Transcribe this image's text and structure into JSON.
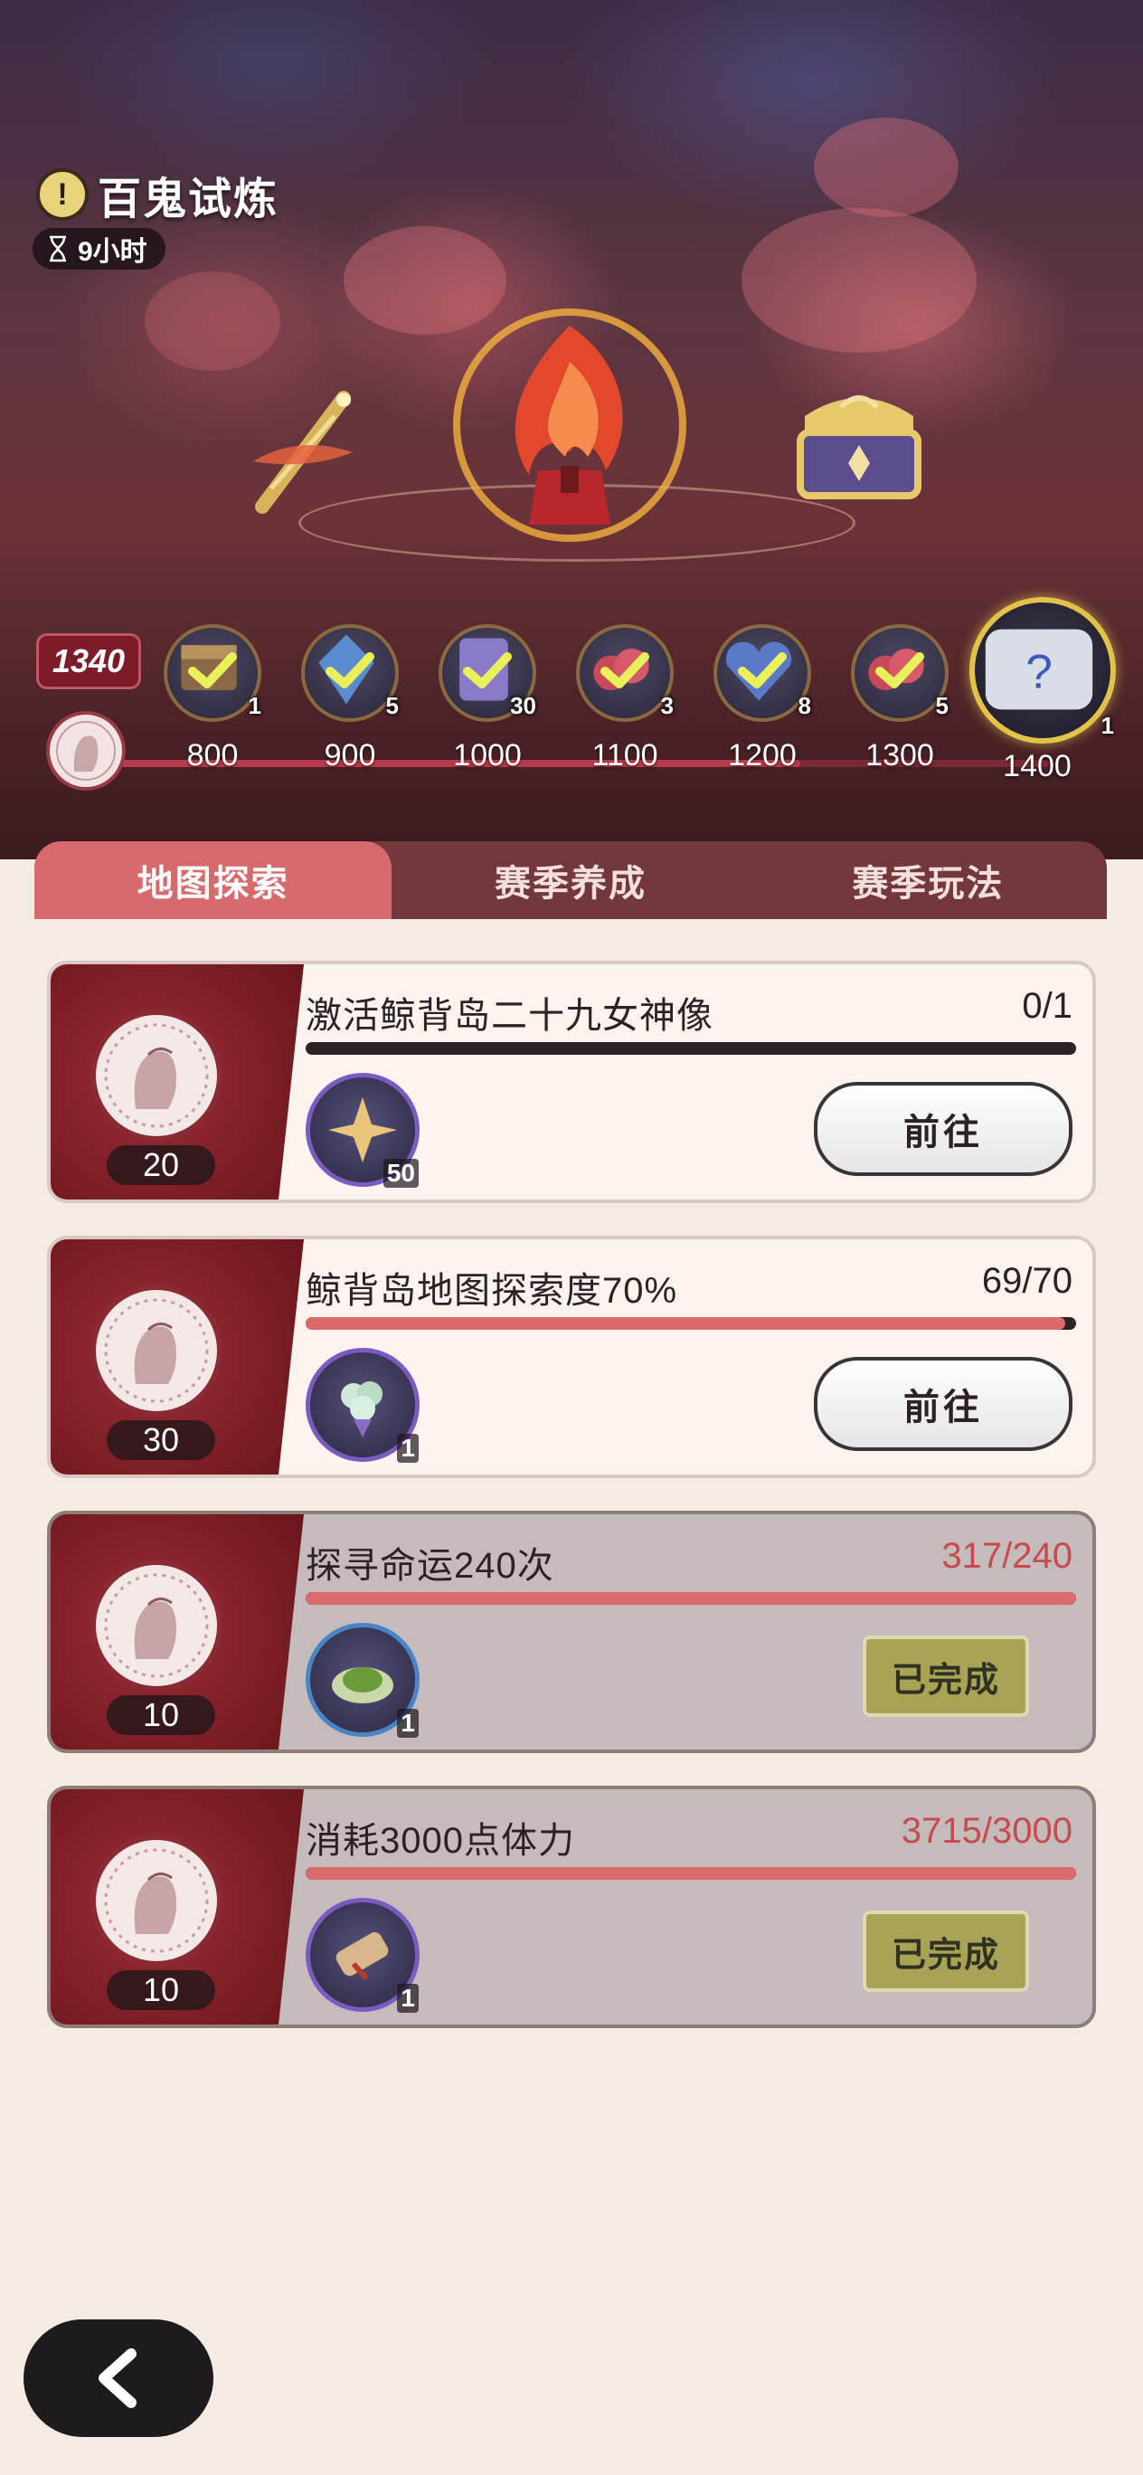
{
  "event": {
    "title": "百鬼试炼",
    "timer": "9小时"
  },
  "milestones": {
    "current_score": "1340",
    "current_progress": 0.75,
    "items": [
      {
        "threshold": "800",
        "count": "1",
        "icon": "chest-box-icon",
        "claimed": true
      },
      {
        "threshold": "900",
        "count": "5",
        "icon": "blue-crystal-icon",
        "claimed": true
      },
      {
        "threshold": "1000",
        "count": "30",
        "icon": "purple-card-icon",
        "claimed": true
      },
      {
        "threshold": "1100",
        "count": "3",
        "icon": "red-fruit-icon",
        "claimed": true
      },
      {
        "threshold": "1200",
        "count": "8",
        "icon": "blue-heart-icon",
        "claimed": true
      },
      {
        "threshold": "1300",
        "count": "5",
        "icon": "red-fruit-icon",
        "claimed": true
      },
      {
        "threshold": "1400",
        "count": "1",
        "icon": "mystery-chest-icon",
        "claimed": false
      }
    ]
  },
  "tabs": [
    {
      "label": "地图探索",
      "active": true
    },
    {
      "label": "赛季养成",
      "active": false
    },
    {
      "label": "赛季玩法",
      "active": false
    }
  ],
  "tasks": [
    {
      "title": "激活鲸背岛二十九女神像",
      "progress": "0/1",
      "ratio": 0.0,
      "points": "20",
      "reward_count": "50",
      "reward_icon": "gold-star-crystal-icon",
      "action": "前往",
      "done": false
    },
    {
      "title": "鲸背岛地图探索度70%",
      "progress": "69/70",
      "ratio": 0.986,
      "points": "30",
      "reward_count": "1",
      "reward_icon": "flower-bouquet-icon",
      "action": "前往",
      "done": false
    },
    {
      "title": "探寻命运240次",
      "progress": "317/240",
      "ratio": 1.0,
      "points": "10",
      "reward_count": "1",
      "reward_icon": "green-dish-icon",
      "action": "已完成",
      "done": true
    },
    {
      "title": "消耗3000点体力",
      "progress": "3715/3000",
      "ratio": 1.0,
      "points": "10",
      "reward_count": "1",
      "reward_icon": "scroll-icon",
      "action": "已完成",
      "done": true
    }
  ],
  "colors": {
    "accent": "#d76a6c",
    "tab_bar": "#73383c",
    "done_badge": "#a8a355",
    "progress_fill": "#dc6a6c"
  }
}
